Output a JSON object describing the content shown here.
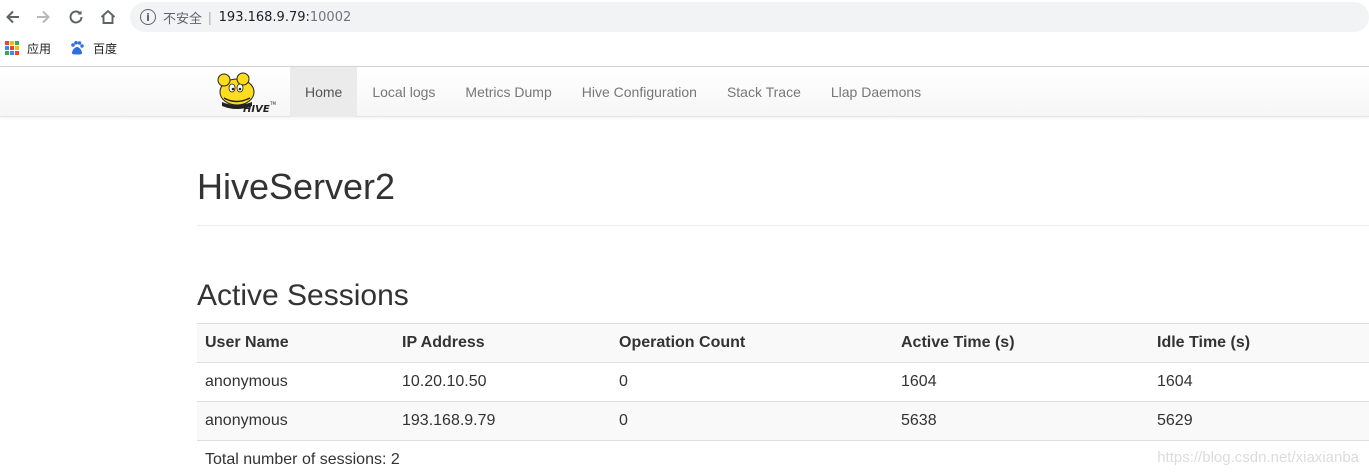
{
  "browser": {
    "security_label": "不安全",
    "url_host": "193.168.9.79:",
    "url_port": "10002",
    "bookmarks": [
      {
        "label": "应用",
        "icon": "apps-grid-icon"
      },
      {
        "label": "百度",
        "icon": "baidu-paw-icon"
      }
    ]
  },
  "navbar": {
    "logo": "hive-logo",
    "items": [
      "Home",
      "Local logs",
      "Metrics Dump",
      "Hive Configuration",
      "Stack Trace",
      "Llap Daemons"
    ],
    "active_item": "Home"
  },
  "page": {
    "title": "HiveServer2",
    "section_title": "Active Sessions"
  },
  "sessions_table": {
    "headers": [
      "User Name",
      "IP Address",
      "Operation Count",
      "Active Time (s)",
      "Idle Time (s)"
    ],
    "rows": [
      [
        "anonymous",
        "10.20.10.50",
        "0",
        "1604",
        "1604"
      ],
      [
        "anonymous",
        "193.168.9.79",
        "0",
        "5638",
        "5629"
      ]
    ],
    "footer": "Total number of sessions: 2"
  },
  "watermark": "https://blog.csdn.net/xiaxianba",
  "colors": {
    "navbar_text": "#777777",
    "active_tab_bg": "#ebebeb",
    "text": "#333333"
  }
}
